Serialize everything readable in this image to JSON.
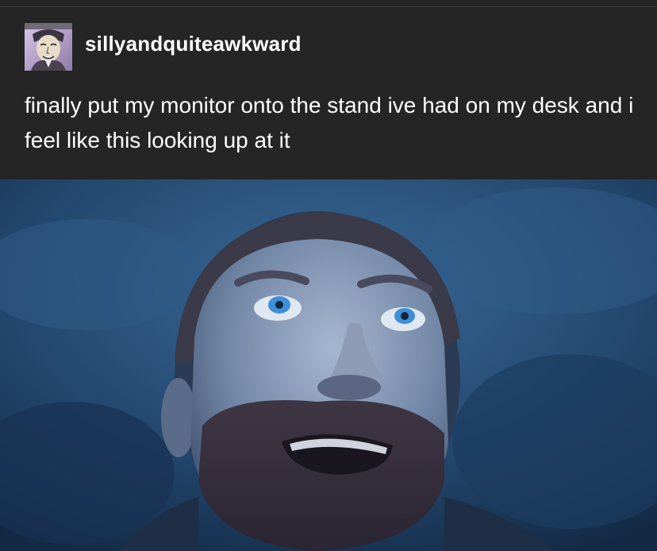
{
  "post": {
    "username": "sillyandquiteawkward",
    "caption": "finally put my monitor onto the stand ive had on my desk and i feel like this looking up at it",
    "avatar_icon": "cartoon-face-avatar",
    "image_icon": "man-looking-up-photo"
  },
  "colors": {
    "background": "#252525",
    "text": "#ffffff",
    "photo_tint": "#2a4a6e"
  }
}
